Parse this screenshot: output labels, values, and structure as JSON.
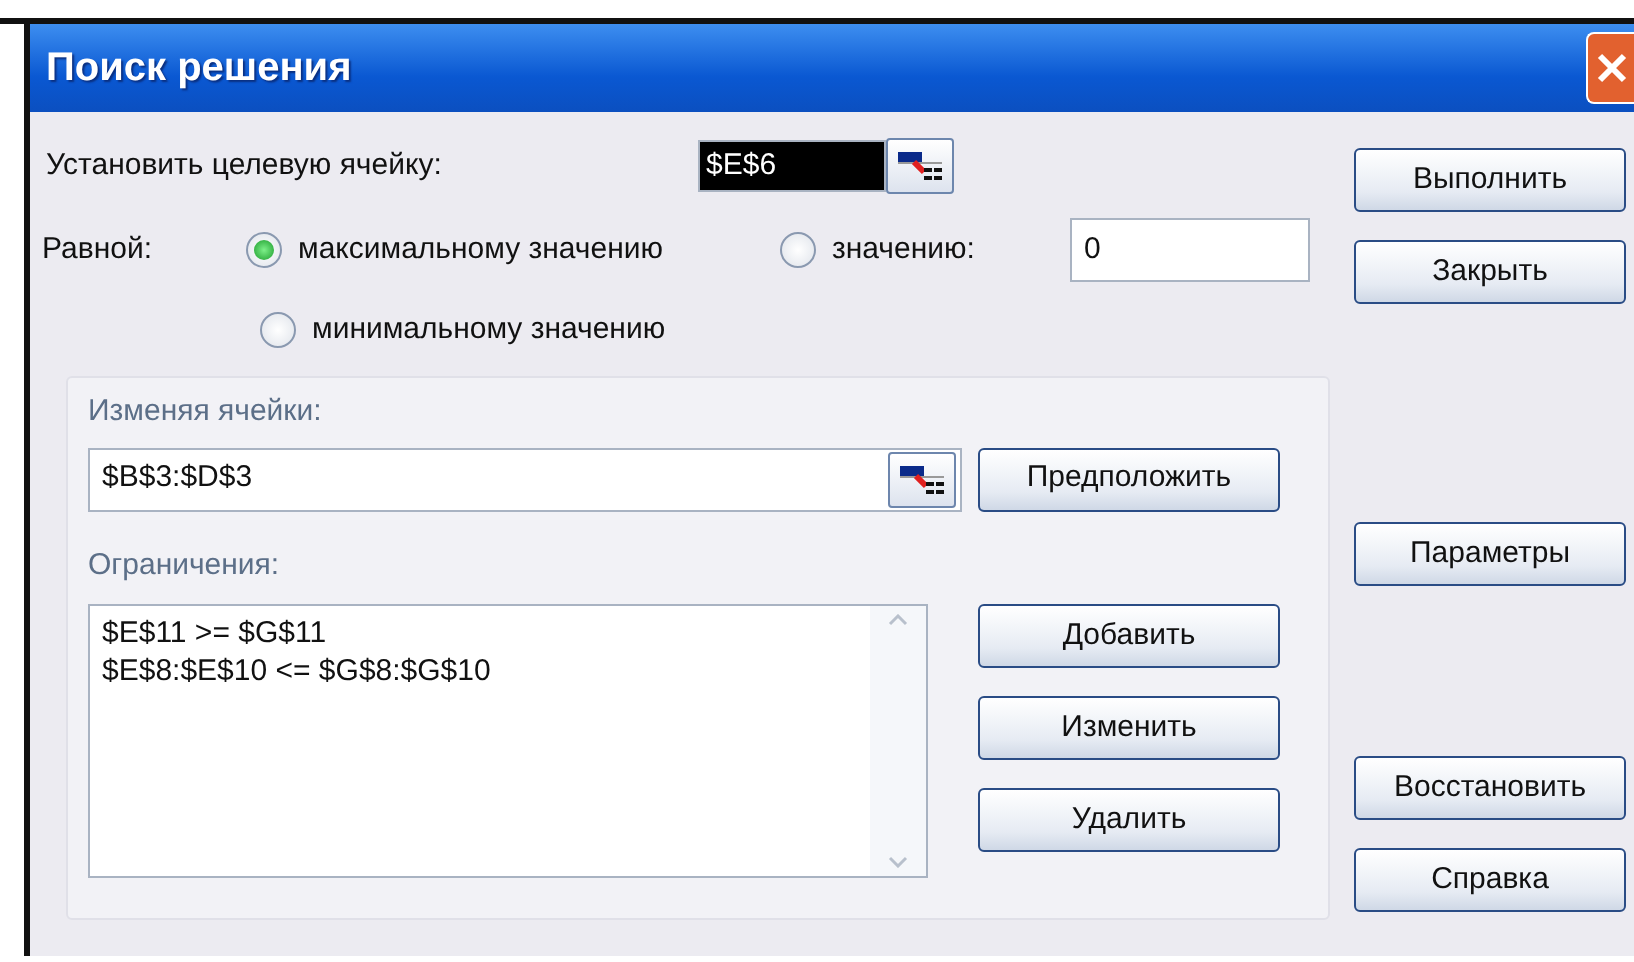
{
  "window": {
    "title": "Поиск решения"
  },
  "target_cell": {
    "label": "Установить целевую ячейку:",
    "value": "$E$6",
    "selected": true
  },
  "equal_to": {
    "label": "Равной:",
    "options": [
      {
        "label": "максимальному значению",
        "selected": true
      },
      {
        "label": "значению:",
        "selected": false
      },
      {
        "label": "минимальному значению",
        "selected": false
      }
    ],
    "value": "0"
  },
  "changing_cells": {
    "label": "Изменяя ячейки:",
    "value": "$B$3:$D$3",
    "button": "Предположить"
  },
  "constraints": {
    "label": "Ограничения:",
    "items": [
      "$E$11 >= $G$11",
      "$E$8:$E$10 <= $G$8:$G$10"
    ],
    "buttons": [
      "Добавить",
      "Изменить",
      "Удалить"
    ]
  },
  "side_buttons": [
    "Выполнить",
    "Закрыть",
    "Параметры",
    "Восстановить",
    "Справка"
  ]
}
